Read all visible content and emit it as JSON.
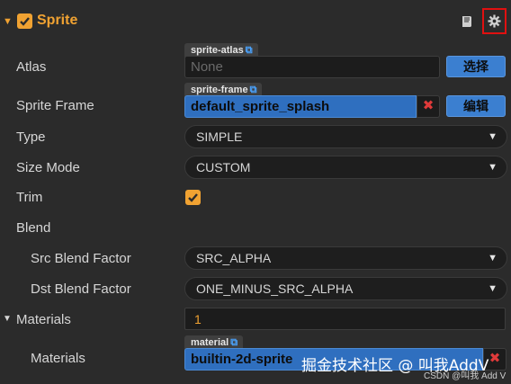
{
  "component": {
    "title": "Sprite",
    "enabled": true
  },
  "properties": {
    "atlas": {
      "label": "Atlas",
      "tag": "sprite-atlas",
      "value": "None",
      "button": "选择"
    },
    "sprite_frame": {
      "label": "Sprite Frame",
      "tag": "sprite-frame",
      "value": "default_sprite_splash",
      "clear_icon": "✖",
      "button": "编辑"
    },
    "type": {
      "label": "Type",
      "value": "SIMPLE"
    },
    "size_mode": {
      "label": "Size Mode",
      "value": "CUSTOM"
    },
    "trim": {
      "label": "Trim",
      "checked": true
    },
    "blend": {
      "label": "Blend",
      "src": {
        "label": "Src Blend Factor",
        "value": "SRC_ALPHA"
      },
      "dst": {
        "label": "Dst Blend Factor",
        "value": "ONE_MINUS_SRC_ALPHA"
      }
    },
    "materials": {
      "label": "Materials",
      "count": "1",
      "item_label": "Materials",
      "item_tag": "material",
      "item_value": "builtin-2d-sprite"
    }
  },
  "watermark": {
    "text": "掘金技术社区 @ 叫我AddV",
    "csdn": "CSDN @叫我 Add V"
  },
  "colors": {
    "accent": "#f0a232",
    "button_blue": "#3b7fd0",
    "highlight_red": "#e01010"
  },
  "icons": [
    "collapse-arrow-icon",
    "checkbox-icon",
    "book-icon",
    "gear-icon",
    "external-link-icon",
    "clear-x-icon",
    "dropdown-caret-icon"
  ]
}
